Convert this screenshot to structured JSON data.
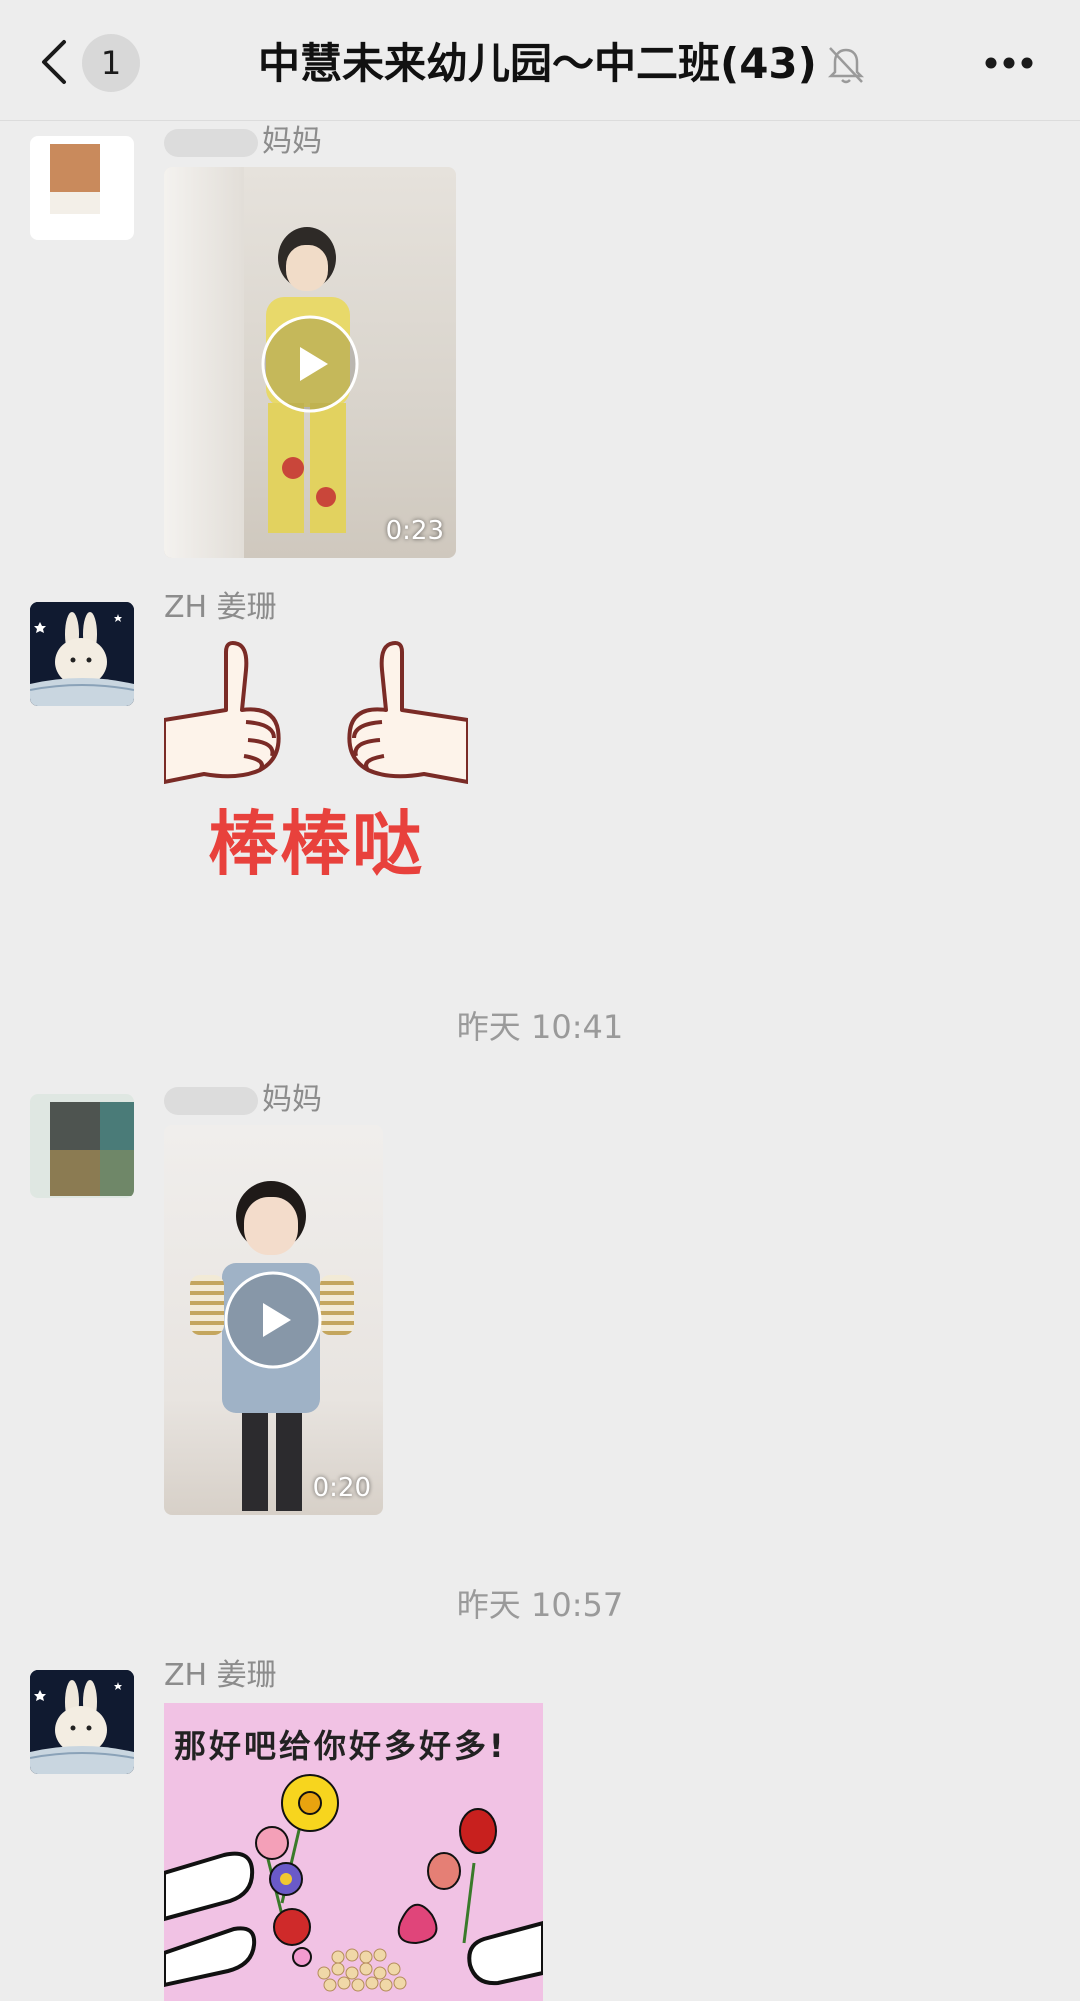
{
  "header": {
    "unread_count": "1",
    "title": "中慧未来幼儿园～中二班(43)"
  },
  "messages": [
    {
      "sender_suffix": "妈妈",
      "duration": "0:23"
    },
    {
      "sender": "ZH 姜珊",
      "sticker_text": "棒棒哒"
    },
    {
      "sender_suffix": "妈妈",
      "duration": "0:20"
    },
    {
      "sender": "ZH 姜珊",
      "sticker_text": "那好吧给你好多好多!"
    }
  ],
  "timestamps": [
    "昨天 10:41",
    "昨天 10:57"
  ],
  "colors": {
    "background": "#ededed",
    "sticker_red": "#e8413c",
    "sticker_pink": "#f1c2e4"
  }
}
